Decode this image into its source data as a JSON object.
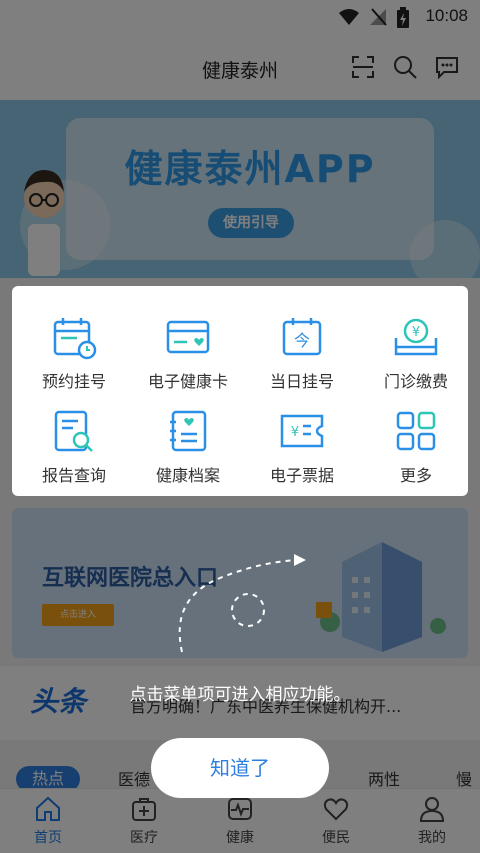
{
  "status_bar": {
    "time": "10:08"
  },
  "header": {
    "title": "健康泰州"
  },
  "banner": {
    "title": "健康泰州APP",
    "guide_label": "使用引导"
  },
  "menu": {
    "items": [
      {
        "label": "预约挂号",
        "icon": "calendar-clock-icon"
      },
      {
        "label": "电子健康卡",
        "icon": "health-card-icon"
      },
      {
        "label": "当日挂号",
        "icon": "today-calendar-icon"
      },
      {
        "label": "门诊缴费",
        "icon": "yen-payment-icon"
      },
      {
        "label": "报告查询",
        "icon": "report-search-icon"
      },
      {
        "label": "健康档案",
        "icon": "health-record-icon"
      },
      {
        "label": "电子票据",
        "icon": "e-ticket-icon"
      },
      {
        "label": "更多",
        "icon": "grid-more-icon"
      }
    ]
  },
  "promo": {
    "title": "互联网医院总入口",
    "button_label": "点击进入"
  },
  "news": {
    "logo": "头条",
    "headline": "官方明确！广东中医养生保健机构开..."
  },
  "chips": {
    "active": "热点",
    "items": [
      "医德",
      "两性",
      "慢"
    ]
  },
  "tabbar": {
    "items": [
      {
        "label": "首页",
        "icon": "home-icon"
      },
      {
        "label": "医疗",
        "icon": "medical-kit-icon"
      },
      {
        "label": "健康",
        "icon": "heartbeat-icon"
      },
      {
        "label": "便民",
        "icon": "heart-hand-icon"
      },
      {
        "label": "我的",
        "icon": "user-icon"
      }
    ]
  },
  "overlay": {
    "hint": "点击菜单项可进入相应功能。",
    "confirm_label": "知道了"
  },
  "colors": {
    "accent": "#1e7be5",
    "icon_blue": "#2a8fe6",
    "icon_teal": "#2ec4b6",
    "banner_bg": "#8ec9ea"
  }
}
